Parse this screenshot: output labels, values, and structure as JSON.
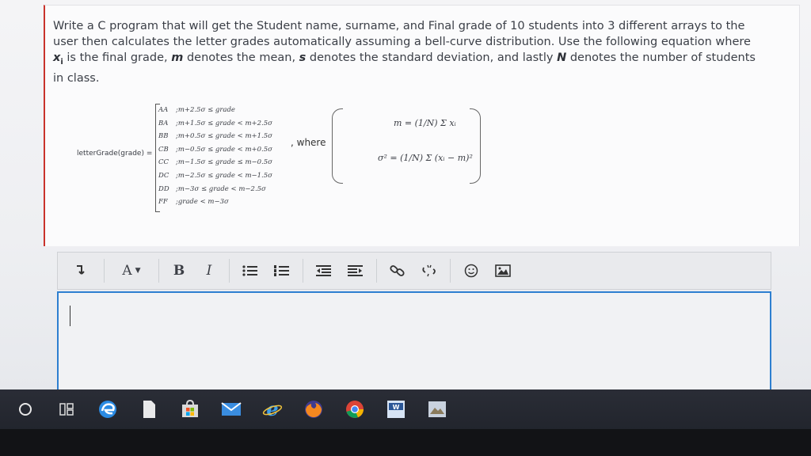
{
  "question": {
    "line1": "Write a C program that will get the Student name, surname, and Final grade of 10 students into 3 different arrays to the",
    "line2": "user then calculates the letter grades automatically assuming a bell-curve distribution. Use the following equation where",
    "line3_xi": "x",
    "line3_sub": "i",
    "line3_a": " is the final grade, ",
    "line3_m": "m",
    "line3_b": " denotes the mean, ",
    "line3_s": "s",
    "line3_c": " denotes the standard deviation, and lastly ",
    "line3_N": "N",
    "line3_d": " denotes the number of students",
    "line4": "in class."
  },
  "equation": {
    "function_label": "letterGrade(grade) =",
    "cases": [
      {
        "grade": "AA",
        "cond": ";m+2.5σ ≤ grade"
      },
      {
        "grade": "BA",
        "cond": ";m+1.5σ ≤ grade < m+2.5σ"
      },
      {
        "grade": "BB",
        "cond": ";m+0.5σ ≤ grade < m+1.5σ"
      },
      {
        "grade": "CB",
        "cond": ";m−0.5σ ≤ grade < m+0.5σ"
      },
      {
        "grade": "CC",
        "cond": ";m−1.5σ ≤ grade ≤ m−0.5σ"
      },
      {
        "grade": "DC",
        "cond": ";m−2.5σ ≤ grade < m−1.5σ"
      },
      {
        "grade": "DD",
        "cond": ";m−3σ ≤ grade < m−2.5σ"
      },
      {
        "grade": "FF",
        "cond": ";grade < m−3σ"
      }
    ],
    "where": ", where",
    "mean_formula": "m = (1/N) Σ xᵢ",
    "variance_formula": "σ² = (1/N) Σ (xᵢ − m)²"
  },
  "toolbar": {
    "indent_icon": "paragraph-indent-icon",
    "font_label": "A",
    "bold_label": "B",
    "italic_label": "I",
    "icons": [
      "bullet-list-icon",
      "numbered-list-icon",
      "outdent-icon",
      "indent-icon",
      "link-icon",
      "unlink-icon",
      "emoji-icon",
      "image-icon"
    ]
  },
  "taskbar": {
    "icons": [
      "start-icon",
      "task-view-icon",
      "edge-icon",
      "file-icon",
      "store-icon",
      "mail-icon",
      "ie-icon",
      "firefox-icon",
      "chrome-icon",
      "word-icon",
      "image-viewer-icon"
    ]
  },
  "colors": {
    "accent_blue": "#2d7fd0",
    "question_border": "#c9332c"
  }
}
